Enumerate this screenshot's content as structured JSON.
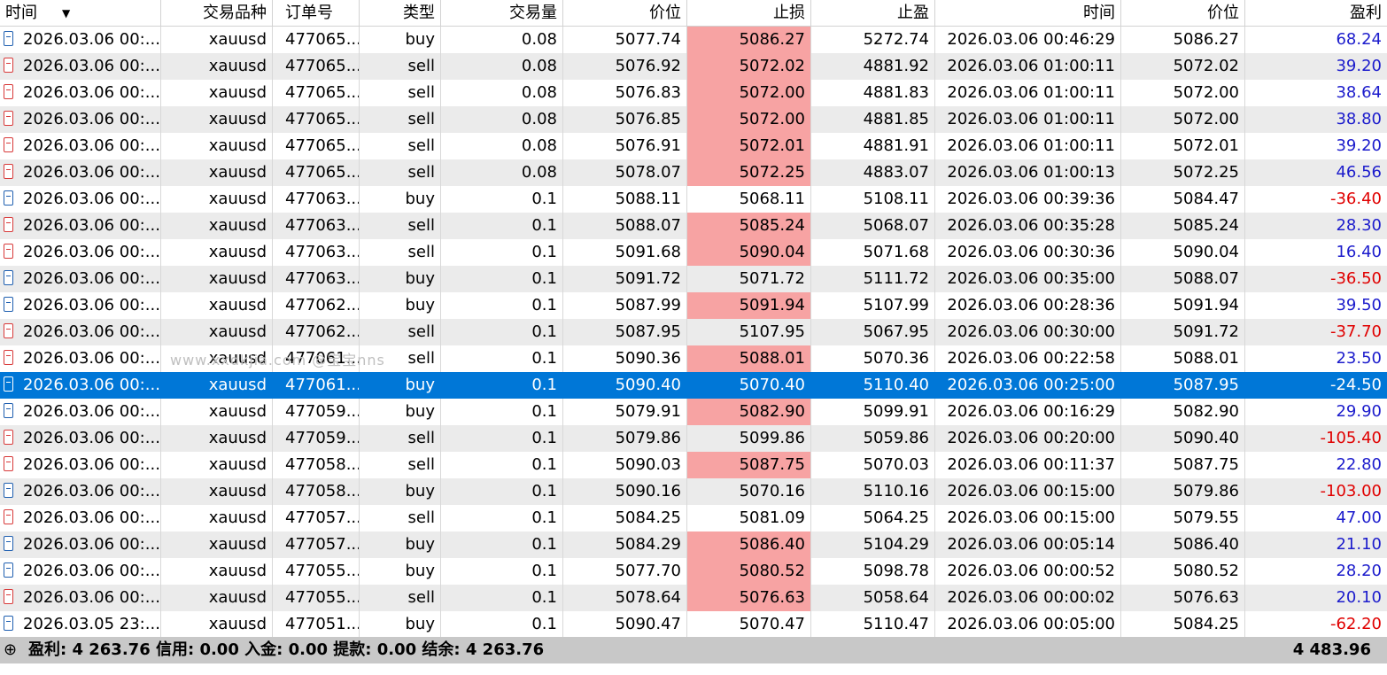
{
  "columns": [
    "时间",
    "交易品种",
    "订单号",
    "类型",
    "交易量",
    "价位",
    "止损",
    "止盈",
    "时间",
    "价位",
    "盈利"
  ],
  "sort_arrow": "▼",
  "colors": {
    "selected_row": "#0077d7",
    "stop_loss_hit": "#f7a3a3",
    "profit_positive": "#1c1ccc",
    "profit_negative": "#e00000",
    "footer_bg": "#c8c8c8"
  },
  "rows": [
    {
      "time": "2026.03.06 00:...",
      "symbol": "xauusd",
      "order": "477065...",
      "type": "buy",
      "volume": "0.08",
      "price": "5077.74",
      "sl": "5086.27",
      "tp": "5272.74",
      "close_time": "2026.03.06 00:46:29",
      "close_price": "5086.27",
      "profit": "68.24",
      "sl_hit": true,
      "neg": false
    },
    {
      "time": "2026.03.06 00:...",
      "symbol": "xauusd",
      "order": "477065...",
      "type": "sell",
      "volume": "0.08",
      "price": "5076.92",
      "sl": "5072.02",
      "tp": "4881.92",
      "close_time": "2026.03.06 01:00:11",
      "close_price": "5072.02",
      "profit": "39.20",
      "sl_hit": true,
      "neg": false
    },
    {
      "time": "2026.03.06 00:...",
      "symbol": "xauusd",
      "order": "477065...",
      "type": "sell",
      "volume": "0.08",
      "price": "5076.83",
      "sl": "5072.00",
      "tp": "4881.83",
      "close_time": "2026.03.06 01:00:11",
      "close_price": "5072.00",
      "profit": "38.64",
      "sl_hit": true,
      "neg": false
    },
    {
      "time": "2026.03.06 00:...",
      "symbol": "xauusd",
      "order": "477065...",
      "type": "sell",
      "volume": "0.08",
      "price": "5076.85",
      "sl": "5072.00",
      "tp": "4881.85",
      "close_time": "2026.03.06 01:00:11",
      "close_price": "5072.00",
      "profit": "38.80",
      "sl_hit": true,
      "neg": false
    },
    {
      "time": "2026.03.06 00:...",
      "symbol": "xauusd",
      "order": "477065...",
      "type": "sell",
      "volume": "0.08",
      "price": "5076.91",
      "sl": "5072.01",
      "tp": "4881.91",
      "close_time": "2026.03.06 01:00:11",
      "close_price": "5072.01",
      "profit": "39.20",
      "sl_hit": true,
      "neg": false
    },
    {
      "time": "2026.03.06 00:...",
      "symbol": "xauusd",
      "order": "477065...",
      "type": "sell",
      "volume": "0.08",
      "price": "5078.07",
      "sl": "5072.25",
      "tp": "4883.07",
      "close_time": "2026.03.06 01:00:13",
      "close_price": "5072.25",
      "profit": "46.56",
      "sl_hit": true,
      "neg": false
    },
    {
      "time": "2026.03.06 00:...",
      "symbol": "xauusd",
      "order": "477063...",
      "type": "buy",
      "volume": "0.1",
      "price": "5088.11",
      "sl": "5068.11",
      "tp": "5108.11",
      "close_time": "2026.03.06 00:39:36",
      "close_price": "5084.47",
      "profit": "-36.40",
      "sl_hit": false,
      "neg": true
    },
    {
      "time": "2026.03.06 00:...",
      "symbol": "xauusd",
      "order": "477063...",
      "type": "sell",
      "volume": "0.1",
      "price": "5088.07",
      "sl": "5085.24",
      "tp": "5068.07",
      "close_time": "2026.03.06 00:35:28",
      "close_price": "5085.24",
      "profit": "28.30",
      "sl_hit": true,
      "neg": false
    },
    {
      "time": "2026.03.06 00:...",
      "symbol": "xauusd",
      "order": "477063...",
      "type": "sell",
      "volume": "0.1",
      "price": "5091.68",
      "sl": "5090.04",
      "tp": "5071.68",
      "close_time": "2026.03.06 00:30:36",
      "close_price": "5090.04",
      "profit": "16.40",
      "sl_hit": true,
      "neg": false
    },
    {
      "time": "2026.03.06 00:...",
      "symbol": "xauusd",
      "order": "477063...",
      "type": "buy",
      "volume": "0.1",
      "price": "5091.72",
      "sl": "5071.72",
      "tp": "5111.72",
      "close_time": "2026.03.06 00:35:00",
      "close_price": "5088.07",
      "profit": "-36.50",
      "sl_hit": false,
      "neg": true
    },
    {
      "time": "2026.03.06 00:...",
      "symbol": "xauusd",
      "order": "477062...",
      "type": "buy",
      "volume": "0.1",
      "price": "5087.99",
      "sl": "5091.94",
      "tp": "5107.99",
      "close_time": "2026.03.06 00:28:36",
      "close_price": "5091.94",
      "profit": "39.50",
      "sl_hit": true,
      "neg": false
    },
    {
      "time": "2026.03.06 00:...",
      "symbol": "xauusd",
      "order": "477062...",
      "type": "sell",
      "volume": "0.1",
      "price": "5087.95",
      "sl": "5107.95",
      "tp": "5067.95",
      "close_time": "2026.03.06 00:30:00",
      "close_price": "5091.72",
      "profit": "-37.70",
      "sl_hit": false,
      "neg": true
    },
    {
      "time": "2026.03.06 00:...",
      "symbol": "xauusd",
      "order": "477061...",
      "type": "sell",
      "volume": "0.1",
      "price": "5090.36",
      "sl": "5088.01",
      "tp": "5070.36",
      "close_time": "2026.03.06 00:22:58",
      "close_price": "5088.01",
      "profit": "23.50",
      "sl_hit": true,
      "neg": false
    },
    {
      "time": "2026.03.06 00:...",
      "symbol": "xauusd",
      "order": "477061...",
      "type": "buy",
      "volume": "0.1",
      "price": "5090.40",
      "sl": "5070.40",
      "tp": "5110.40",
      "close_time": "2026.03.06 00:25:00",
      "close_price": "5087.95",
      "profit": "-24.50",
      "sl_hit": false,
      "neg": true,
      "selected": true
    },
    {
      "time": "2026.03.06 00:...",
      "symbol": "xauusd",
      "order": "477059...",
      "type": "buy",
      "volume": "0.1",
      "price": "5079.91",
      "sl": "5082.90",
      "tp": "5099.91",
      "close_time": "2026.03.06 00:16:29",
      "close_price": "5082.90",
      "profit": "29.90",
      "sl_hit": true,
      "neg": false
    },
    {
      "time": "2026.03.06 00:...",
      "symbol": "xauusd",
      "order": "477059...",
      "type": "sell",
      "volume": "0.1",
      "price": "5079.86",
      "sl": "5099.86",
      "tp": "5059.86",
      "close_time": "2026.03.06 00:20:00",
      "close_price": "5090.40",
      "profit": "-105.40",
      "sl_hit": false,
      "neg": true
    },
    {
      "time": "2026.03.06 00:...",
      "symbol": "xauusd",
      "order": "477058...",
      "type": "sell",
      "volume": "0.1",
      "price": "5090.03",
      "sl": "5087.75",
      "tp": "5070.03",
      "close_time": "2026.03.06 00:11:37",
      "close_price": "5087.75",
      "profit": "22.80",
      "sl_hit": true,
      "neg": false
    },
    {
      "time": "2026.03.06 00:...",
      "symbol": "xauusd",
      "order": "477058...",
      "type": "buy",
      "volume": "0.1",
      "price": "5090.16",
      "sl": "5070.16",
      "tp": "5110.16",
      "close_time": "2026.03.06 00:15:00",
      "close_price": "5079.86",
      "profit": "-103.00",
      "sl_hit": false,
      "neg": true
    },
    {
      "time": "2026.03.06 00:...",
      "symbol": "xauusd",
      "order": "477057...",
      "type": "sell",
      "volume": "0.1",
      "price": "5084.25",
      "sl": "5081.09",
      "tp": "5064.25",
      "close_time": "2026.03.06 00:15:00",
      "close_price": "5079.55",
      "profit": "47.00",
      "sl_hit": false,
      "neg": false
    },
    {
      "time": "2026.03.06 00:...",
      "symbol": "xauusd",
      "order": "477057...",
      "type": "buy",
      "volume": "0.1",
      "price": "5084.29",
      "sl": "5086.40",
      "tp": "5104.29",
      "close_time": "2026.03.06 00:05:14",
      "close_price": "5086.40",
      "profit": "21.10",
      "sl_hit": true,
      "neg": false
    },
    {
      "time": "2026.03.06 00:...",
      "symbol": "xauusd",
      "order": "477055...",
      "type": "buy",
      "volume": "0.1",
      "price": "5077.70",
      "sl": "5080.52",
      "tp": "5098.78",
      "close_time": "2026.03.06 00:00:52",
      "close_price": "5080.52",
      "profit": "28.20",
      "sl_hit": true,
      "neg": false
    },
    {
      "time": "2026.03.06 00:...",
      "symbol": "xauusd",
      "order": "477055...",
      "type": "sell",
      "volume": "0.1",
      "price": "5078.64",
      "sl": "5076.63",
      "tp": "5058.64",
      "close_time": "2026.03.06 00:00:02",
      "close_price": "5076.63",
      "profit": "20.10",
      "sl_hit": true,
      "neg": false
    },
    {
      "time": "2026.03.05 23:...",
      "symbol": "xauusd",
      "order": "477051...",
      "type": "buy",
      "volume": "0.1",
      "price": "5090.47",
      "sl": "5070.47",
      "tp": "5110.47",
      "close_time": "2026.03.06 00:05:00",
      "close_price": "5084.25",
      "profit": "-62.20",
      "sl_hit": false,
      "neg": true
    }
  ],
  "footer": {
    "expand_icon": "⊕",
    "summary": "盈利: 4 263.76  信用: 0.00  入金: 0.00  提款: 0.00  结余: 4 263.76",
    "total": "4 483.96"
  },
  "watermark": "www.xxdkjia.com @宝宝nns"
}
